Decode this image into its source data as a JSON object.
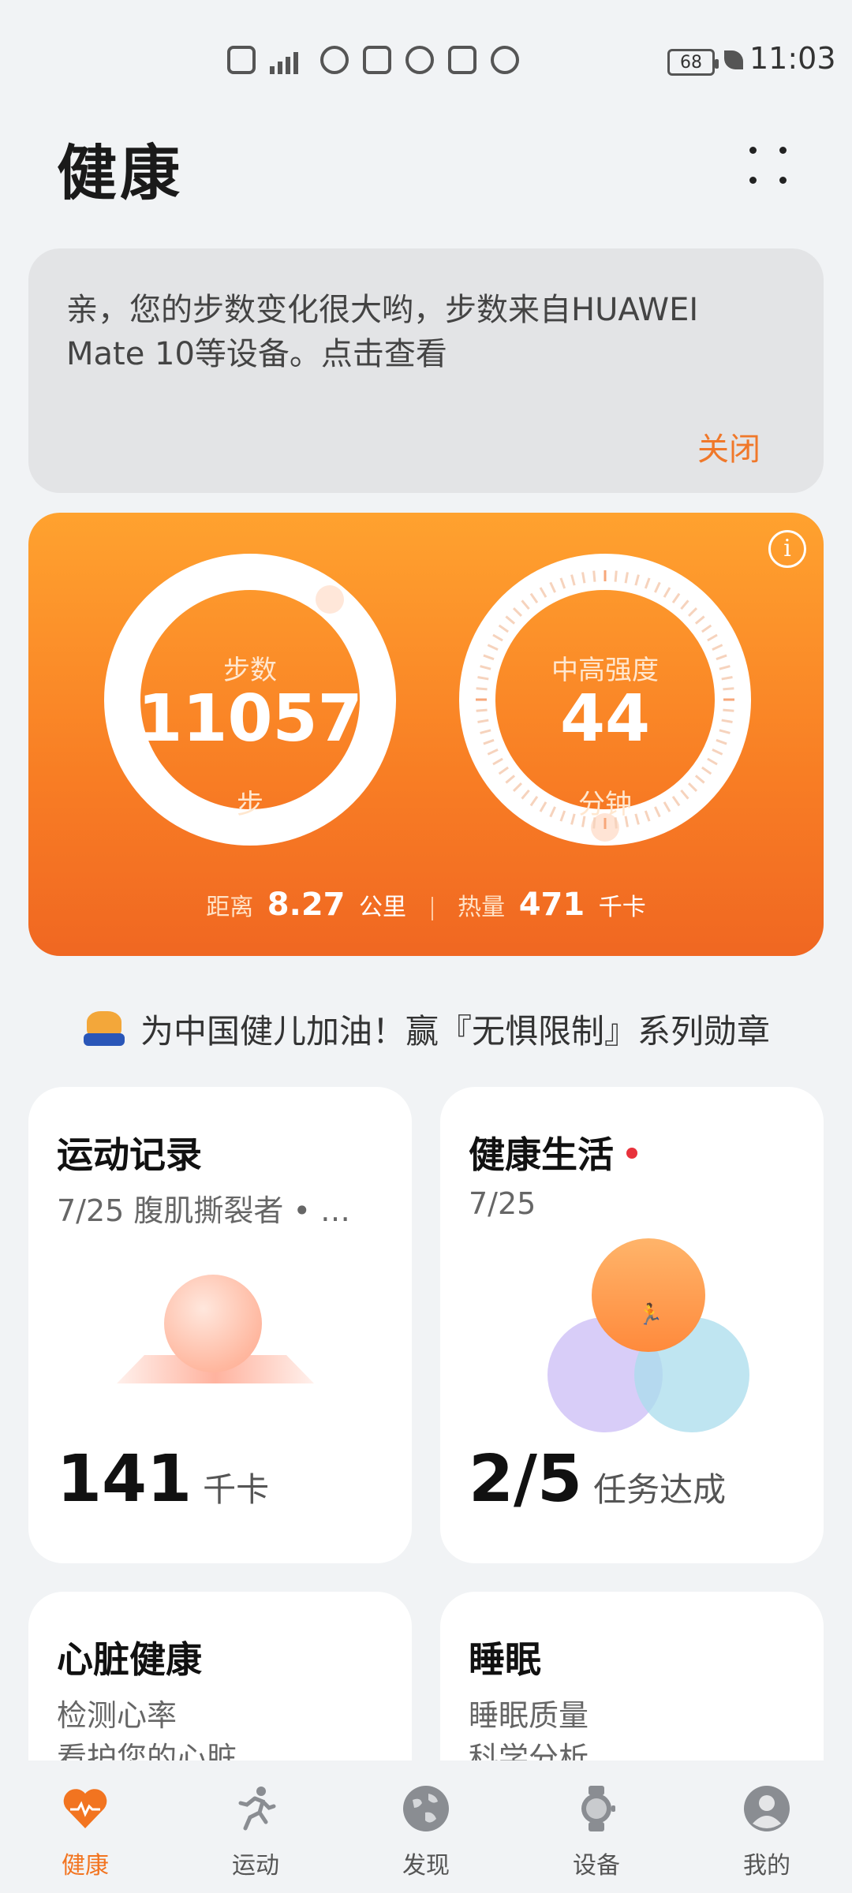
{
  "status_bar": {
    "time": "11:03",
    "battery": "68",
    "icons": [
      "hd-icon",
      "signal-5g-icon",
      "health-icon",
      "alipay-icon",
      "bank-icon",
      "hand-icon",
      "globe-icon"
    ]
  },
  "header": {
    "title": "健康"
  },
  "notice": {
    "text": "亲，您的步数变化很大哟，步数来自HUAWEI Mate 10等设备。点击查看",
    "close_label": "关闭"
  },
  "activity": {
    "steps": {
      "label": "步数",
      "value": "11057",
      "unit": "步"
    },
    "intensity": {
      "label": "中高强度",
      "value": "44",
      "unit": "分钟"
    },
    "distance": {
      "label": "距离",
      "value": "8.27",
      "unit": "公里"
    },
    "calories": {
      "label": "热量",
      "value": "471",
      "unit": "千卡"
    }
  },
  "banner": {
    "text": "为中国健儿加油！赢『无惧限制』系列勋章"
  },
  "tiles": {
    "exercise": {
      "title": "运动记录",
      "subtitle": "7/25 腹肌撕裂者 • …",
      "value": "141",
      "unit": "千卡"
    },
    "healthy_life": {
      "title": "健康生活",
      "subtitle": "7/25",
      "value": "2/5",
      "unit": "任务达成"
    },
    "heart": {
      "title": "心脏健康",
      "line1": "检测心率",
      "line2": "看护您的心脏"
    },
    "sleep": {
      "title": "睡眠",
      "line1": "睡眠质量",
      "line2": "科学分析"
    }
  },
  "nav": [
    {
      "label": "健康",
      "icon": "heart-icon",
      "active": true
    },
    {
      "label": "运动",
      "icon": "running-icon",
      "active": false
    },
    {
      "label": "发现",
      "icon": "globe-icon",
      "active": false
    },
    {
      "label": "设备",
      "icon": "watch-icon",
      "active": false
    },
    {
      "label": "我的",
      "icon": "profile-icon",
      "active": false
    }
  ],
  "colors": {
    "accent": "#f27420",
    "card_orange_top": "#ffa22f",
    "card_orange_bottom": "#f06722",
    "alert_dot": "#e8323c"
  }
}
